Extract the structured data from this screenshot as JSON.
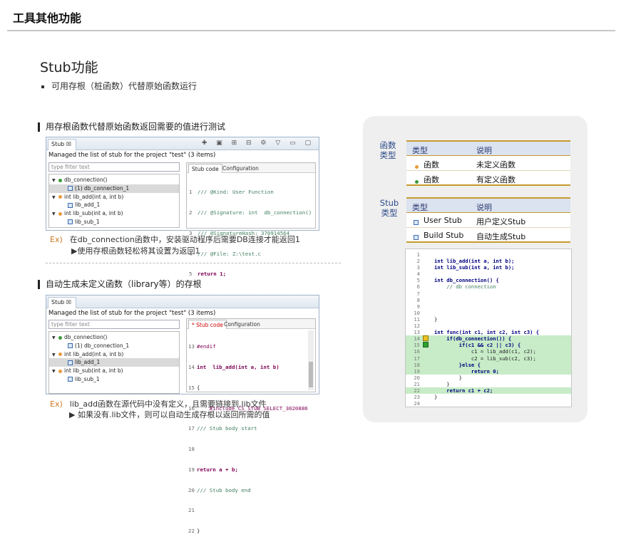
{
  "page_title": "工具其他功能",
  "section_title": "Stub功能",
  "bullet": "可用存根（桩函数）代替原始函数运行",
  "part1": {
    "heading": "用存根函数代替原始函数返回需要的值进行测试",
    "ex_label": "Ex)",
    "ex_text": "在db_connection函数中，安装驱动程序后需要DB连接才能返回1",
    "arrow_text": "▶使用存根函数轻松将其设置为返回1",
    "window": {
      "tab": "Stub ☒",
      "managed": "Managed the list of stub for the project \"test\" (3 items)",
      "filter_placeholder": "type filter text",
      "tree": [
        "db_connection()",
        "(1) db_connection_1",
        "int lib_add(int a, int b)",
        "lib_add_1",
        "int lib_sub(int a, int b)",
        "lib_sub_1"
      ],
      "right_tabs": [
        "Stub code",
        "Configuration"
      ],
      "code": [
        {
          "n": "1",
          "t": "/// @Kind: User Function"
        },
        {
          "n": "2",
          "t": "/// @Signature: int  db_connection()"
        },
        {
          "n": "3",
          "t": "/// @SignatureHash: 370914564"
        },
        {
          "n": "4",
          "t": "/// @File: Z:\\test.c"
        },
        {
          "n": "5",
          "t": "return 1;"
        }
      ]
    }
  },
  "part2": {
    "heading": "自动生成未定义函数（library等）的存根",
    "ex_label": "Ex)",
    "ex_text": "lib_add函数在源代码中没有定义，且需要链接到.lib文件",
    "arrow_text": "▶ 如果没有.lib文件，则可以自动生成存根以返回所需的值",
    "window": {
      "tab": "Stub ☒",
      "managed": "Managed the list of stub for the project \"test\" (3 items)",
      "filter_placeholder": "type filter text",
      "tree": [
        "db_connection()",
        "(1) db_connection_1",
        "int lib_add(int a, int b)",
        "lib_add_1",
        "int lib_sub(int a, int b)",
        "lib_sub_1"
      ],
      "right_tabs": [
        "* Stub code",
        "Configuration"
      ],
      "code": [
        {
          "n": "13",
          "t": "#endif"
        },
        {
          "n": "14",
          "t": "int  lib_add(int a, int b)"
        },
        {
          "n": "15",
          "t": "{"
        },
        {
          "n": "16",
          "t": "    #include CS_STUB_SELECT_3020886800"
        },
        {
          "n": "17",
          "t": "/// Stub body start"
        },
        {
          "n": "18",
          "t": ""
        },
        {
          "n": "19",
          "t": "return a + b;"
        },
        {
          "n": "20",
          "t": "/// Stub body end"
        },
        {
          "n": "21",
          "t": ""
        },
        {
          "n": "22",
          "t": "}"
        }
      ]
    }
  },
  "func_table": {
    "label": "函数\n类型",
    "headers": [
      "类型",
      "说明"
    ],
    "rows": [
      {
        "type": "函数",
        "desc": "未定义函数",
        "color": "#e89b3a"
      },
      {
        "type": "函数",
        "desc": "有定义函数",
        "color": "#3a9a3a"
      }
    ]
  },
  "stub_table": {
    "label": "Stub\n类型",
    "headers": [
      "类型",
      "说明"
    ],
    "rows": [
      {
        "type": "User Stub",
        "desc": "用户定义Stub",
        "icon": "user-stub-icon"
      },
      {
        "type": "Build Stub",
        "desc": "自动生成Stub",
        "icon": "build-stub-icon"
      }
    ]
  },
  "code_window": {
    "lines": [
      {
        "n": "1",
        "t": "",
        "hl": false
      },
      {
        "n": "2",
        "t": "int lib_add(int a, int b);",
        "hl": false
      },
      {
        "n": "3",
        "t": "int lib_sub(int a, int b);",
        "hl": false
      },
      {
        "n": "4",
        "t": "",
        "hl": false
      },
      {
        "n": "5",
        "t": "int db_connection() {",
        "hl": false
      },
      {
        "n": "6",
        "t": "    // db connection",
        "hl": false
      },
      {
        "n": "7",
        "t": "",
        "hl": false
      },
      {
        "n": "8",
        "t": "",
        "hl": false
      },
      {
        "n": "9",
        "t": "",
        "hl": false
      },
      {
        "n": "10",
        "t": "",
        "hl": false
      },
      {
        "n": "11",
        "t": "}",
        "hl": false
      },
      {
        "n": "12",
        "t": "",
        "hl": false
      },
      {
        "n": "13",
        "t": "int func(int c1, int c2, int c3) {",
        "hl": false
      },
      {
        "n": "14",
        "t": "    if(db_connection()) {",
        "hl": true
      },
      {
        "n": "15",
        "t": "        if(c1 && c2 || c3) {",
        "hl": true
      },
      {
        "n": "16",
        "t": "            c1 = lib_add(c1, c2);",
        "hl": true
      },
      {
        "n": "17",
        "t": "            c2 = lib_sub(c2, c3);",
        "hl": true
      },
      {
        "n": "18",
        "t": "        }else {",
        "hl": true
      },
      {
        "n": "19",
        "t": "            return 0;",
        "hl": true
      },
      {
        "n": "20",
        "t": "        }",
        "hl": false
      },
      {
        "n": "21",
        "t": "    }",
        "hl": false
      },
      {
        "n": "22",
        "t": "    return c1 + c2;",
        "hl": true
      },
      {
        "n": "23",
        "t": "}",
        "hl": false
      },
      {
        "n": "24",
        "t": "",
        "hl": false
      }
    ]
  }
}
